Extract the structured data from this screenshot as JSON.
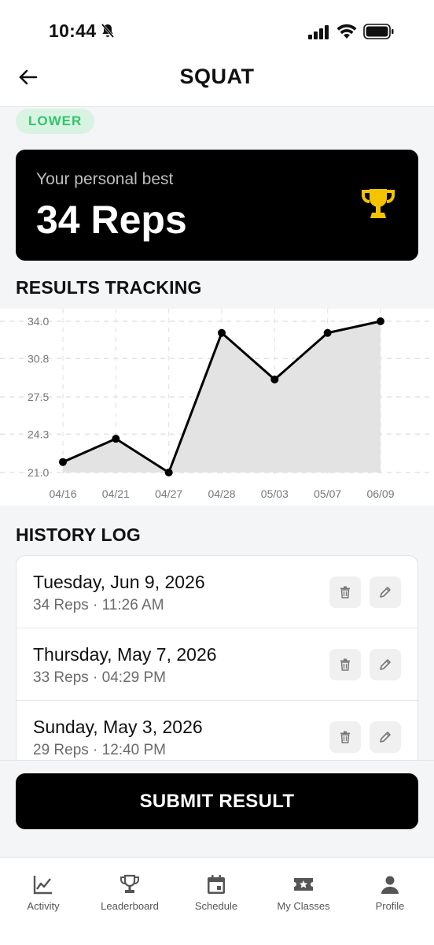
{
  "status_bar": {
    "time": "10:44"
  },
  "header": {
    "title": "SQUAT"
  },
  "tag": {
    "label": "LOWER"
  },
  "personal_best": {
    "label": "Your personal best",
    "value": "34 Reps"
  },
  "results_section": {
    "title": "RESULTS TRACKING"
  },
  "chart_data": {
    "type": "area",
    "x": [
      "04/16",
      "04/21",
      "04/27",
      "04/28",
      "05/03",
      "05/07",
      "06/09"
    ],
    "values": [
      21.9,
      23.9,
      21.0,
      33.0,
      29.0,
      33.0,
      34.0
    ],
    "y_ticks": [
      "34.0",
      "30.8",
      "27.5",
      "24.3",
      "21.0"
    ],
    "ylim": [
      21.0,
      34.0
    ],
    "grid": true,
    "line_color": "#000000",
    "fill_color": "#e3e3e3"
  },
  "history_section": {
    "title": "HISTORY LOG"
  },
  "history": [
    {
      "date": "Tuesday, Jun 9, 2026",
      "meta": "34 Reps · 11:26 AM"
    },
    {
      "date": "Thursday, May 7, 2026",
      "meta": "33 Reps · 04:29 PM"
    },
    {
      "date": "Sunday, May 3, 2026",
      "meta": "29 Reps · 12:40 PM"
    }
  ],
  "submit": {
    "label": "SUBMIT RESULT"
  },
  "tabs": [
    {
      "label": "Activity",
      "icon": "chart-icon"
    },
    {
      "label": "Leaderboard",
      "icon": "trophy-icon"
    },
    {
      "label": "Schedule",
      "icon": "calendar-icon"
    },
    {
      "label": "My Classes",
      "icon": "ticket-icon"
    },
    {
      "label": "Profile",
      "icon": "person-icon"
    }
  ],
  "colors": {
    "accent": "#000000",
    "tag_bg": "#d9f3e3",
    "tag_text": "#34c46b",
    "trophy": "#f5c400"
  }
}
